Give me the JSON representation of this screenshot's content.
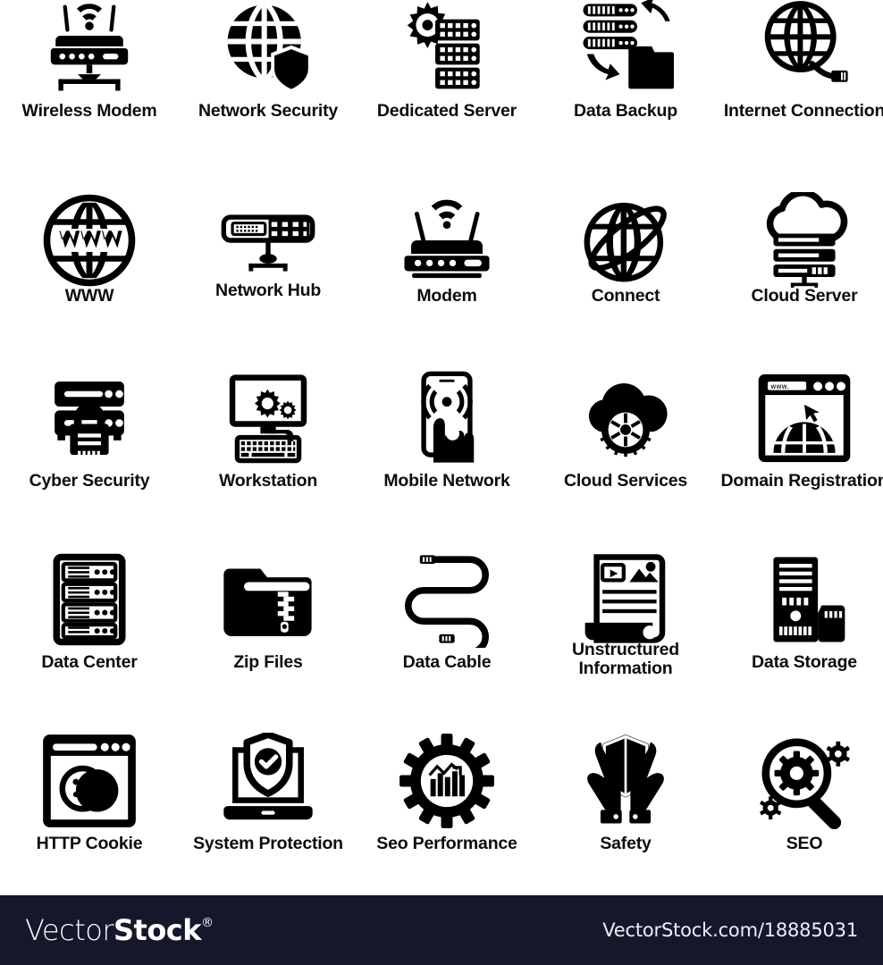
{
  "page": {
    "background_color": "#ffffff",
    "icon_color": "#000000",
    "label_color": "#0c0c11",
    "columns": 5,
    "rows": 5
  },
  "icons": [
    {
      "label": "Wireless Modem",
      "icon": "wireless-modem-icon"
    },
    {
      "label": "Network Security",
      "icon": "network-security-icon"
    },
    {
      "label": "Dedicated Server",
      "icon": "dedicated-server-icon"
    },
    {
      "label": "Data Backup",
      "icon": "data-backup-icon"
    },
    {
      "label": "Internet Connection",
      "icon": "internet-connection-icon"
    },
    {
      "label": "WWW",
      "icon": "www-globe-icon"
    },
    {
      "label": "Network Hub",
      "icon": "network-hub-icon"
    },
    {
      "label": "Modem",
      "icon": "modem-icon"
    },
    {
      "label": "Connect",
      "icon": "connect-orbit-globe-icon"
    },
    {
      "label": "Cloud Server",
      "icon": "cloud-server-icon"
    },
    {
      "label": "Cyber Security",
      "icon": "cyber-security-icon"
    },
    {
      "label": "Workstation",
      "icon": "workstation-icon"
    },
    {
      "label": "Mobile Network",
      "icon": "mobile-network-icon"
    },
    {
      "label": "Cloud Services",
      "icon": "cloud-services-icon"
    },
    {
      "label": "Domain Registration",
      "icon": "domain-registration-icon"
    },
    {
      "label": "Data Center",
      "icon": "data-center-icon"
    },
    {
      "label": "Zip Files",
      "icon": "zip-files-icon"
    },
    {
      "label": "Data Cable",
      "icon": "data-cable-icon"
    },
    {
      "label": "Unstructured\nInformation",
      "icon": "unstructured-information-icon"
    },
    {
      "label": "Data Storage",
      "icon": "data-storage-icon"
    },
    {
      "label": "HTTP Cookie",
      "icon": "http-cookie-icon"
    },
    {
      "label": "System Protection",
      "icon": "system-protection-icon"
    },
    {
      "label": "Seo Performance",
      "icon": "seo-performance-icon"
    },
    {
      "label": "Safety",
      "icon": "safety-shield-hands-icon"
    },
    {
      "label": "SEO",
      "icon": "seo-magnifier-gear-icon"
    }
  ],
  "watermark": {
    "brand_light": "Vector",
    "brand_bold": "Stock",
    "brand_registered": "®",
    "url": "VectorStock.com/18885031",
    "bar_color": "#16172b",
    "text_color": "#ffffff"
  }
}
